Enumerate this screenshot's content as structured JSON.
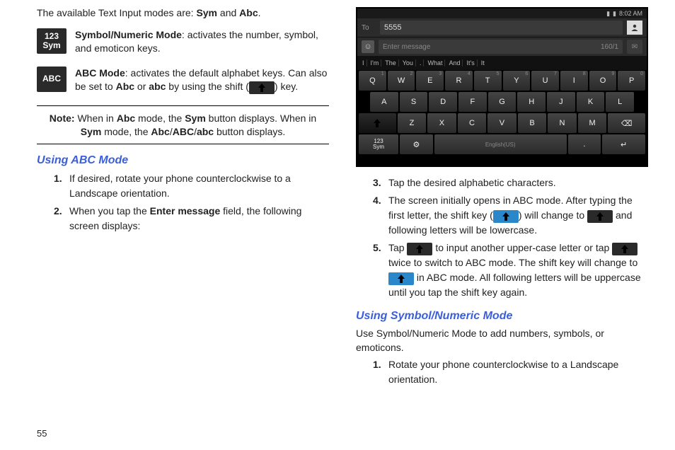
{
  "pageNumber": "55",
  "intro": {
    "pre": "The available Text Input modes are: ",
    "b1": "Sym",
    "mid": " and ",
    "b2": "Abc",
    "post": "."
  },
  "modes": {
    "sym": {
      "key_line1": "123",
      "key_line2": "Sym",
      "title": "Symbol/Numeric Mode",
      "desc": ": activates the number, symbol, and emoticon keys."
    },
    "abc": {
      "key_line1": "ABC",
      "title": "ABC Mode",
      "desc1": ": activates the default alphabet keys. Can also be set to ",
      "b1": "Abc",
      "desc2": " or ",
      "b2": "abc",
      "desc3": " by using the shift (",
      "desc4": ") key."
    }
  },
  "note": {
    "label": "Note:",
    "t1": " When in ",
    "b1": "Abc",
    "t2": " mode, the ",
    "b2": "Sym",
    "t3": " button displays. When in ",
    "b3": "Sym",
    "t4": " mode, the ",
    "b4": "Abc",
    "slash1": "/",
    "b5": "ABC",
    "slash2": "/",
    "b6": "abc",
    "t5": " button displays."
  },
  "abcSection": {
    "heading": "Using ABC Mode",
    "step1_num": "1.",
    "step1": "If desired, rotate your phone counterclockwise to a Landscape orientation.",
    "step2_num": "2.",
    "step2_a": "When you tap the ",
    "step2_b": "Enter message",
    "step2_c": " field, the following screen displays:",
    "step3_num": "3.",
    "step3": "Tap the desired alphabetic characters.",
    "step4_num": "4.",
    "step4_a": "The screen initially opens in ABC mode. After typing the first letter, the shift key (",
    "step4_b": ") will change to ",
    "step4_c": " and following letters will be lowercase.",
    "step5_num": "5.",
    "step5_a": "Tap ",
    "step5_b": " to input another upper-case letter or tap ",
    "step5_c": " twice to switch to ABC mode. The shift key will change to ",
    "step5_d": " in ABC mode. All following letters will be uppercase until you tap the shift key again."
  },
  "symSection": {
    "heading": "Using Symbol/Numeric Mode",
    "intro": "Use Symbol/Numeric Mode to add numbers, symbols, or emoticons.",
    "step1_num": "1.",
    "step1": "Rotate your phone counterclockwise to a Landscape orientation."
  },
  "phone": {
    "time": "8:02 AM",
    "toLabel": "To",
    "toValue": "5555",
    "msgPlaceholder": "Enter message",
    "charCount": "160/1",
    "predict": [
      "I",
      "I'm",
      "The",
      "You",
      ".",
      "What",
      "And",
      "It's",
      "It"
    ],
    "row1": [
      "Q",
      "W",
      "E",
      "R",
      "T",
      "Y",
      "U",
      "I",
      "O",
      "P"
    ],
    "row2": [
      "A",
      "S",
      "D",
      "F",
      "G",
      "H",
      "J",
      "K",
      "L"
    ],
    "row3_shift": "⇧",
    "row3": [
      "Z",
      "X",
      "C",
      "V",
      "B",
      "N",
      "M"
    ],
    "row3_del": "⌫",
    "sym_l1": "123",
    "sym_l2": "Sym",
    "space": "English(US)",
    "enter": "↵"
  }
}
